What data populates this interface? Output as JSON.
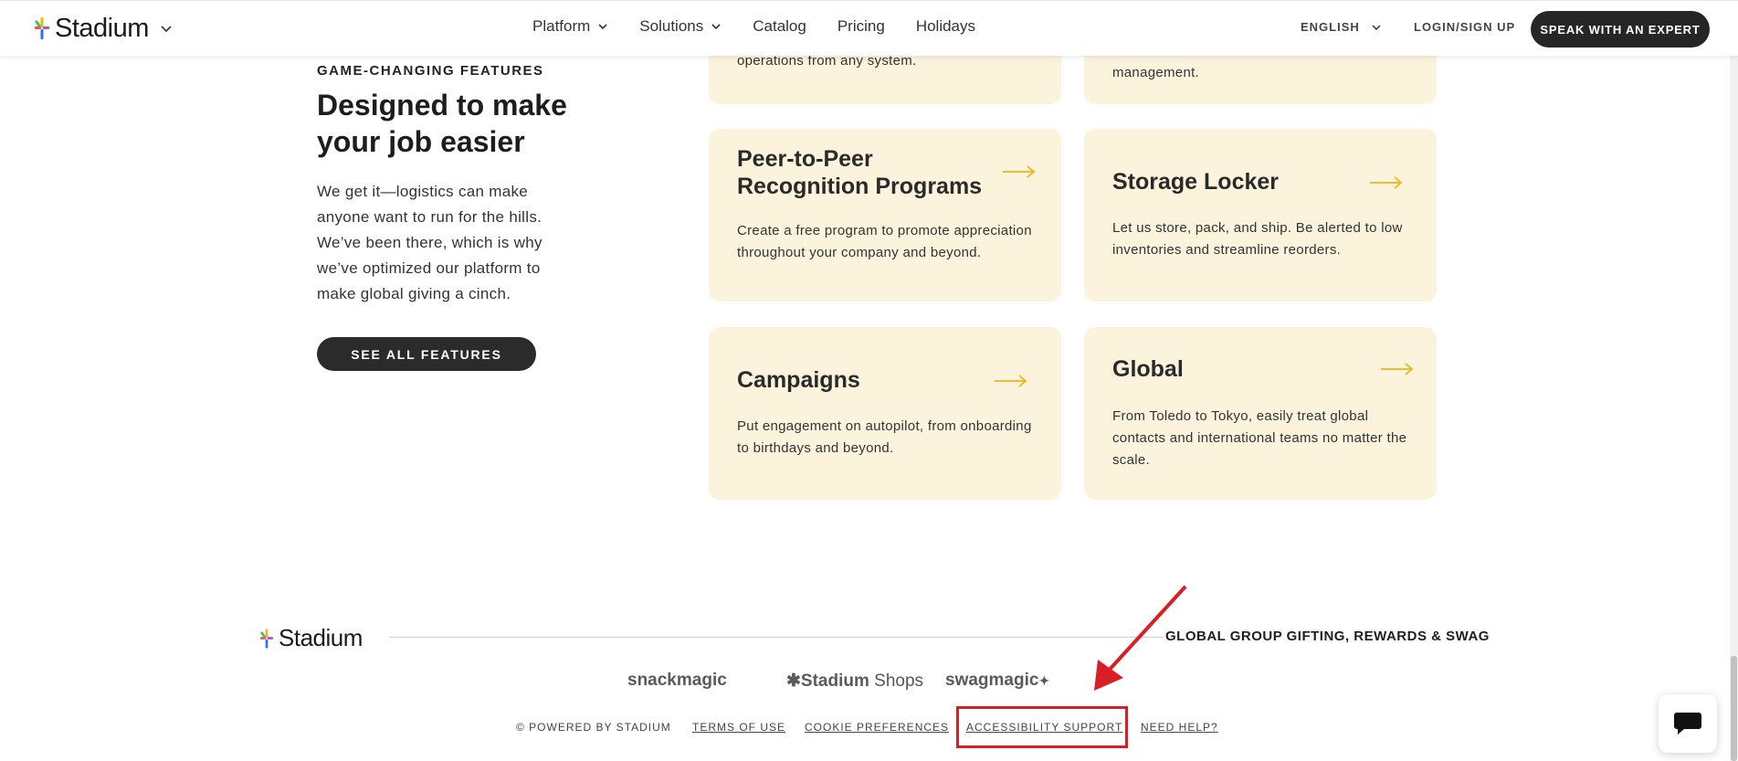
{
  "header": {
    "logo_text": "Stadium",
    "nav": [
      {
        "label": "Platform",
        "has_dropdown": true
      },
      {
        "label": "Solutions",
        "has_dropdown": true
      },
      {
        "label": "Catalog",
        "has_dropdown": false
      },
      {
        "label": "Pricing",
        "has_dropdown": false
      },
      {
        "label": "Holidays",
        "has_dropdown": false
      }
    ],
    "language": "ENGLISH",
    "login": "LOGIN/SIGN UP",
    "cta": "SPEAK WITH AN EXPERT"
  },
  "intro": {
    "eyebrow": "GAME-CHANGING FEATURES",
    "heading": "Designed to make your job easier",
    "body": "We get it—logistics can make anyone want to run for the hills. We’ve been there, which is why we’ve optimized our platform to make global giving a cinch.",
    "button": "SEE ALL FEATURES"
  },
  "cards_partial": [
    {
      "desc_fragment": "operations from any system."
    },
    {
      "desc_fragment": "management."
    }
  ],
  "cards": [
    {
      "title": "Peer-to-Peer Recognition Programs",
      "desc": "Create a free program to promote appreciation throughout your company and beyond."
    },
    {
      "title": "Storage Locker",
      "desc": "Let us store, pack, and ship. Be alerted to low inventories and streamline reorders."
    },
    {
      "title": "Campaigns",
      "desc": "Put engagement on autopilot, from onboarding to birthdays and beyond."
    },
    {
      "title": "Global",
      "desc": "From Toledo to Tokyo, easily treat global contacts and international teams no matter the scale."
    }
  ],
  "footer": {
    "logo_text": "Stadium",
    "tagline": "GLOBAL GROUP GIFTING, REWARDS & SWAG",
    "brands": [
      "snackmagic",
      "Stadium",
      "Shops",
      "swagmagic"
    ],
    "powered": "© POWERED BY STADIUM",
    "links": [
      "TERMS OF USE",
      "COOKIE PREFERENCES",
      "ACCESSIBILITY SUPPORT",
      "NEED HELP?"
    ]
  },
  "colors": {
    "card_bg": "#fbf3dc",
    "arrow": "#f3b31b",
    "dark_button": "#262626",
    "annotation": "#d81f26"
  }
}
